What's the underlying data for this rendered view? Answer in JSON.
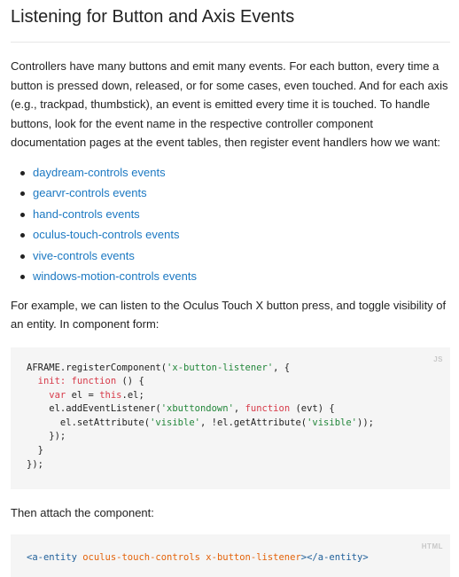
{
  "heading": "Listening for Button and Axis Events",
  "intro": "Controllers have many buttons and emit many events. For each button, every time a button is pressed down, released, or for some cases, even touched. And for each axis (e.g., trackpad, thumbstick), an event is emitted every time it is touched. To handle buttons, look for the event name in the respective controller component documentation pages at the event tables, then register event handlers how we want:",
  "links": [
    "daydream-controls events",
    "gearvr-controls events",
    "hand-controls events",
    "oculus-touch-controls events",
    "vive-controls events",
    "windows-motion-controls events"
  ],
  "example_text": "For example, we can listen to the Oculus Touch X button press, and toggle visibility of an entity. In component form:",
  "code_js": {
    "lang": "JS",
    "line1_a": "AFRAME.registerComponent(",
    "line1_str": "'x-button-listener'",
    "line1_b": ", {",
    "line2_a": "  init: ",
    "line2_kw": "function",
    "line2_b": " () {",
    "line3_kw": "    var",
    "line3_a": " el = ",
    "line3_kw2": "this",
    "line3_b": ".el;",
    "line4_a": "    el.addEventListener(",
    "line4_str": "'xbuttondown'",
    "line4_b": ", ",
    "line4_kw": "function",
    "line4_c": " (evt) {",
    "line5_a": "      el.setAttribute(",
    "line5_str": "'visible'",
    "line5_b": ", !el.getAttribute(",
    "line5_str2": "'visible'",
    "line5_c": "));",
    "line6": "    });",
    "line7": "  }",
    "line8": "});"
  },
  "attach_text": "Then attach the component:",
  "code_html": {
    "lang": "HTML",
    "open_tag": "<a-entity",
    "attrs": " oculus-touch-controls x-button-listener",
    "close_tag": "></a-entity>"
  },
  "colors": {
    "link": "#1b78c2",
    "code_bg": "#f5f5f5",
    "keyword": "#d73a49",
    "string": "#22863a"
  }
}
